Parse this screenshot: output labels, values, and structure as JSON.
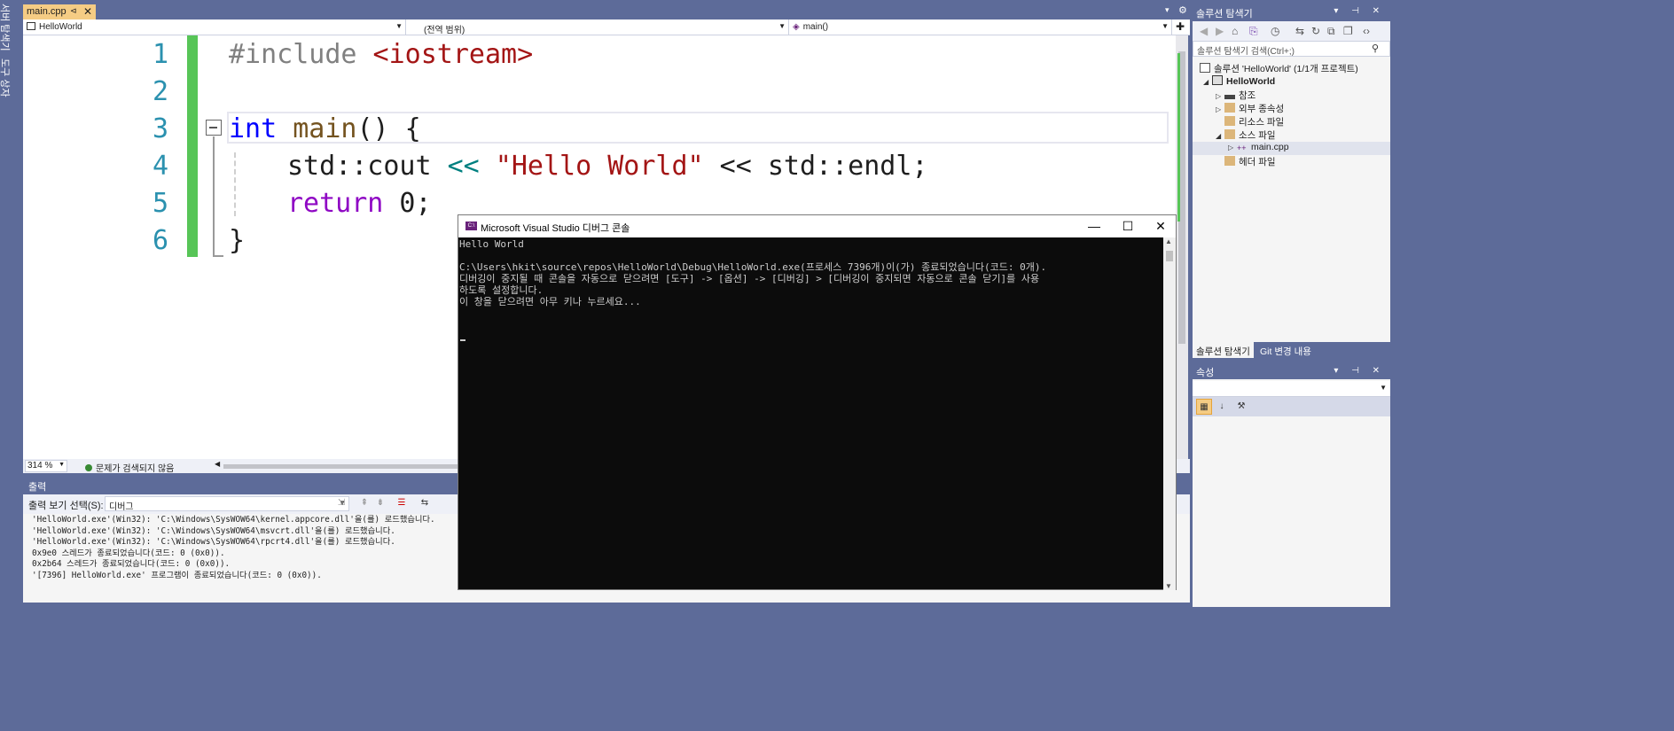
{
  "side_tabs": [
    "서버 탐색기",
    "도구 상자"
  ],
  "doc_tab": {
    "label": "main.cpp",
    "pin": "⊲",
    "close": "✕"
  },
  "navbar": {
    "project": "HelloWorld",
    "scope": "(전역 범위)",
    "member": "main()"
  },
  "editor": {
    "line_numbers": [
      "1",
      "2",
      "3",
      "4",
      "5",
      "6"
    ],
    "lines": {
      "l1_pp": "#include",
      "l1_str": " <iostream>",
      "l3_kw": "int",
      "l3_fn": " main",
      "l3_rest": "() {",
      "l4_a": "std::cout ",
      "l4_op": "<<",
      "l4_str": " \"Hello World\"",
      "l4_b": " << std::endl;",
      "l5_kw": "return",
      "l5_rest": " 0;",
      "l6": "}"
    },
    "zoom": "314 %",
    "issues": "문제가 검색되지 않음"
  },
  "output": {
    "title": "출력",
    "source_label": "출력 보기 선택(S):",
    "source_value": "디버그",
    "lines": [
      "'HelloWorld.exe'(Win32): 'C:\\Windows\\SysWOW64\\kernel.appcore.dll'을(를) 로드했습니다.",
      "'HelloWorld.exe'(Win32): 'C:\\Windows\\SysWOW64\\msvcrt.dll'을(를) 로드했습니다.",
      "'HelloWorld.exe'(Win32): 'C:\\Windows\\SysWOW64\\rpcrt4.dll'을(를) 로드했습니다.",
      "0x9e0 스레드가 종료되었습니다(코드: 0 (0x0)).",
      "0x2b64 스레드가 종료되었습니다(코드: 0 (0x0)).",
      "'[7396] HelloWorld.exe' 프로그램이 종료되었습니다(코드: 0 (0x0))."
    ]
  },
  "console": {
    "title": "Microsoft Visual Studio 디버그 콘솔",
    "icon_text": "C:\\",
    "minimize": "—",
    "maximize": "☐",
    "close": "✕",
    "lines": [
      "Hello World",
      "",
      "C:\\Users\\hkit\\source\\repos\\HelloWorld\\Debug\\HelloWorld.exe(프로세스 7396개)이(가) 종료되었습니다(코드: 0개).",
      "디버깅이 중지될 때 콘솔을 자동으로 닫으려면 [도구] -> [옵션] -> [디버깅] > [디버깅이 중지되면 자동으로 콘솔 닫기]를 사용",
      "하도록 설정합니다.",
      "이 창을 닫으려면 아무 키나 누르세요..."
    ]
  },
  "solution_explorer": {
    "title": "솔루션 탐색기",
    "search_placeholder": "솔루션 탐색기 검색(Ctrl+;)",
    "items": [
      {
        "label": "솔루션 'HelloWorld' (1/1개 프로젝트)"
      },
      {
        "label": "HelloWorld"
      },
      {
        "label": "참조"
      },
      {
        "label": "외부 종속성"
      },
      {
        "label": "리소스 파일"
      },
      {
        "label": "소스 파일"
      },
      {
        "label": "main.cpp"
      },
      {
        "label": "헤더 파일"
      }
    ],
    "tabs": [
      "솔루션 탐색기",
      "Git 변경 내용"
    ]
  },
  "properties": {
    "title": "속성"
  },
  "colors": {
    "accent": "#5d6b99",
    "active_tab": "#f5cc84",
    "change_bar": "#57c557",
    "console_bg": "#0c0c0c"
  }
}
